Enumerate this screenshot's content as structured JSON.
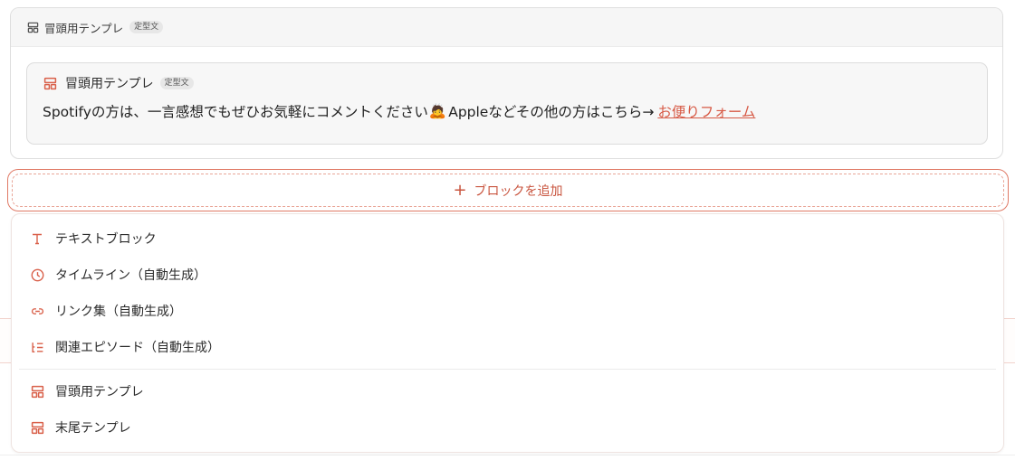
{
  "outer_block": {
    "title": "冒頭用テンプレ",
    "badge": "定型文",
    "inner": {
      "title": "冒頭用テンプレ",
      "badge": "定型文",
      "text": "Spotifyの方は、一言感想でもぜひお気軽にコメントください",
      "emoji": "🙇",
      "text_after": "Appleなどその他の方はこちら→",
      "link": "お便りフォーム"
    }
  },
  "add_block": {
    "label": "ブロックを追加"
  },
  "dropdown": {
    "items": [
      {
        "label": "テキストブロック",
        "icon": "text-icon"
      },
      {
        "label": "タイムライン（自動生成）",
        "icon": "clock-icon"
      },
      {
        "label": "リンク集（自動生成）",
        "icon": "link-icon"
      },
      {
        "label": "関連エピソード（自動生成）",
        "icon": "list-tree-icon"
      },
      {
        "label": "冒頭用テンプレ",
        "icon": "template-icon"
      },
      {
        "label": "末尾テンプレ",
        "icon": "template-icon"
      }
    ]
  },
  "colors": {
    "accent": "#d9604a",
    "link": "#d75a46"
  }
}
